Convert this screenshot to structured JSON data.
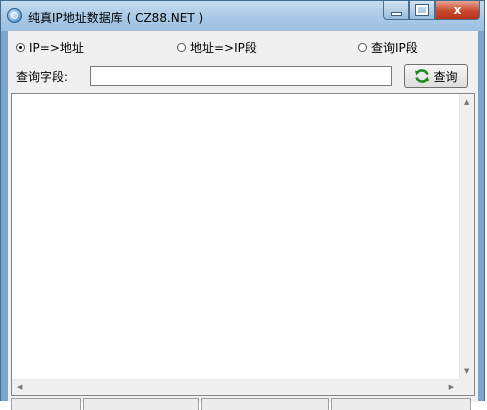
{
  "window": {
    "title": "纯真IP地址数据库 ( CZ88.NET )",
    "close_glyph": "x"
  },
  "search_mode": {
    "options": [
      {
        "label": "IP=>地址",
        "checked": true
      },
      {
        "label": "地址=>IP段",
        "checked": false
      },
      {
        "label": "查询IP段",
        "checked": false
      }
    ]
  },
  "query": {
    "label": "查询字段:",
    "value": "",
    "button_label": "查询"
  },
  "results": {
    "text": ""
  },
  "colors": {
    "accent": "#7aa6cc",
    "refresh_icon": "#1e8a1e"
  }
}
